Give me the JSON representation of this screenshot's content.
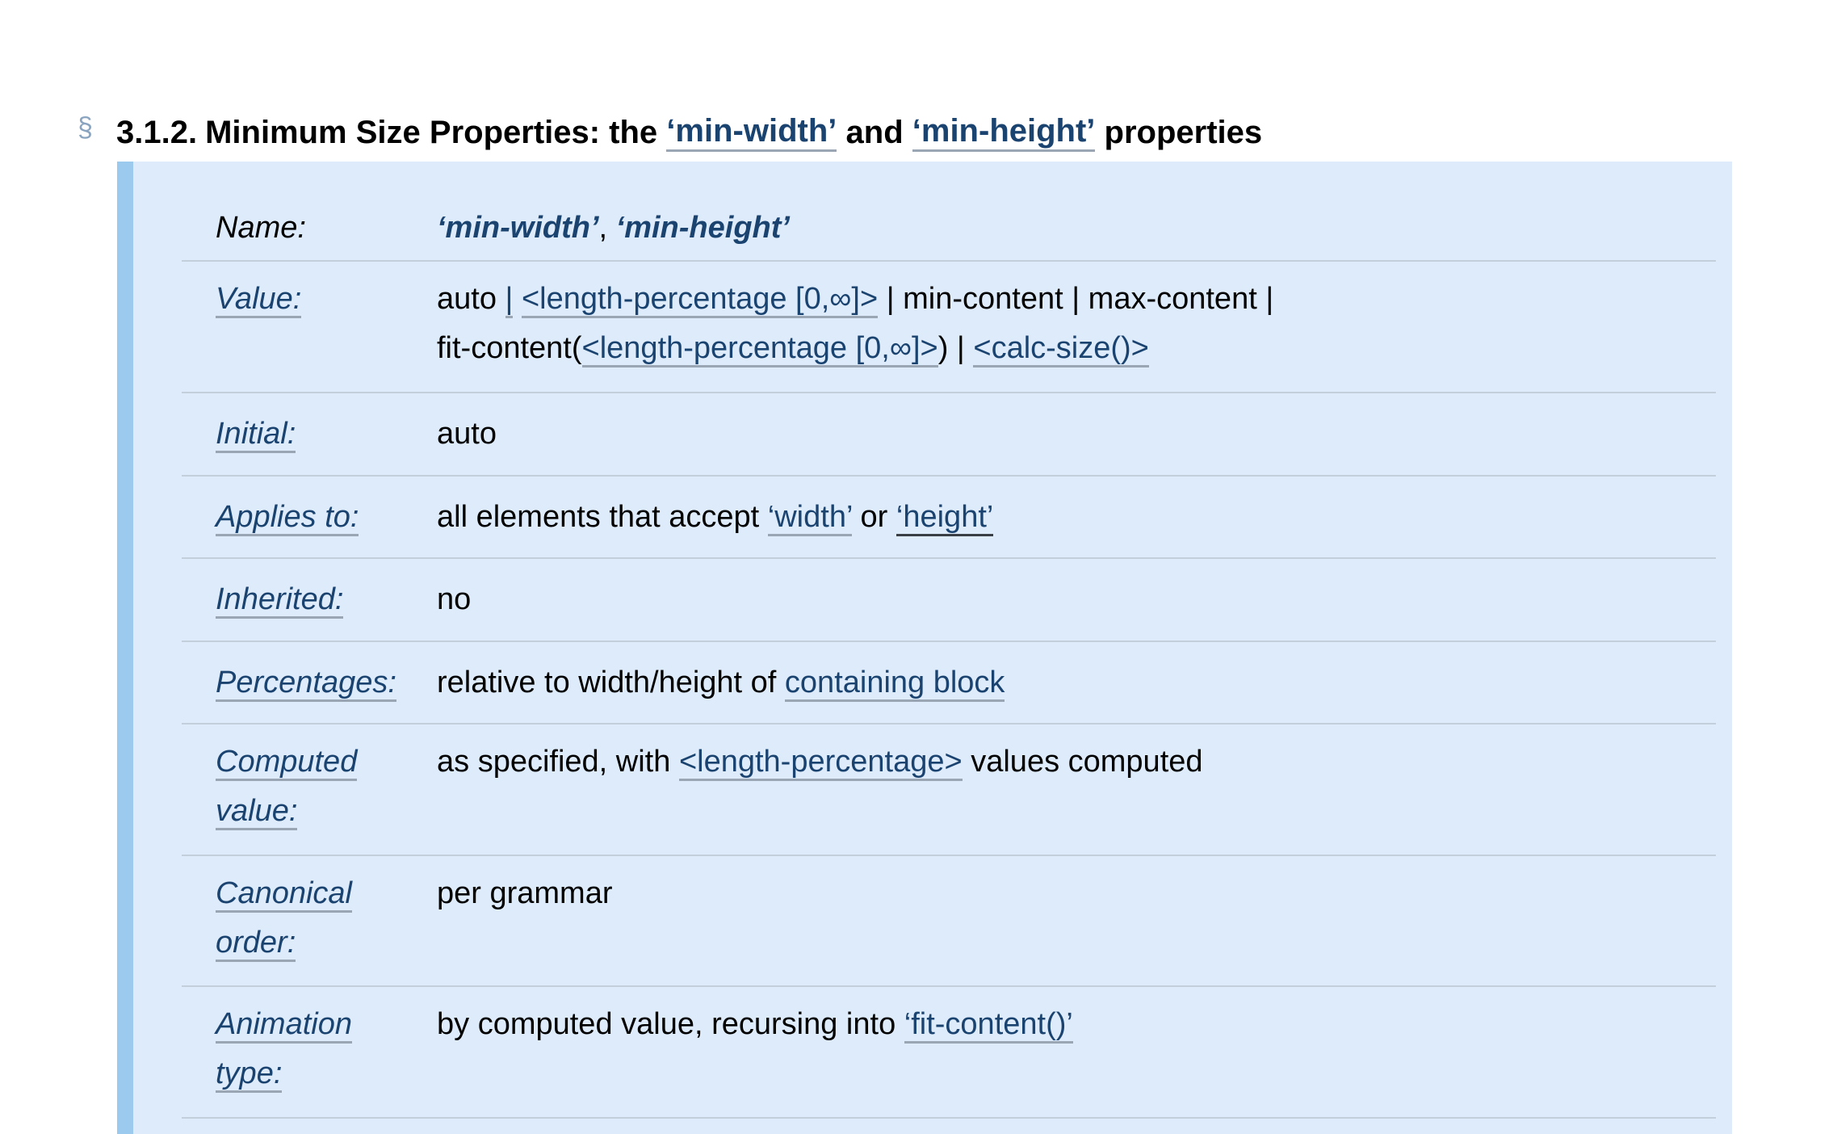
{
  "heading": {
    "section_sign": "§",
    "number": "3.1.2.",
    "text_before": "Minimum Size Properties: the",
    "link1": "‘min-width’",
    "text_middle": "and",
    "link2": "‘min-height’",
    "text_after": "properties"
  },
  "propdef": {
    "name": {
      "label": "Name:",
      "value1": "‘min-width’",
      "separator": ",",
      "value2": "‘min-height’"
    },
    "value": {
      "label": "Value:",
      "part1": "auto",
      "bar1": "|",
      "link_lp1": "<length-percentage [0,∞]>",
      "part2": "| min-content | max-content |",
      "part3": "fit-content(",
      "link_lp2": "<length-percentage [0,∞]>",
      "part4": ") |",
      "link_calc": "<calc-size()>"
    },
    "initial": {
      "label": "Initial:",
      "value": "auto"
    },
    "applies": {
      "label": "Applies to:",
      "text": "all elements that accept",
      "link_width": "‘width’",
      "or": "or",
      "link_height": "‘height’"
    },
    "inherited": {
      "label": "Inherited:",
      "value": "no"
    },
    "percentages": {
      "label": "Percentages:",
      "text": "relative to width/height of",
      "link": "containing block"
    },
    "computed": {
      "label_line1": "Computed",
      "label_line2": "value:",
      "text1": "as specified, with",
      "link": "<length-percentage>",
      "text2": "values computed"
    },
    "canonical": {
      "label_line1": "Canonical",
      "label_line2": "order:",
      "value": "per grammar"
    },
    "animation": {
      "label_line1": "Animation",
      "label_line2": "type:",
      "text": "by computed value, recursing into",
      "link": "‘fit-content()’"
    }
  }
}
